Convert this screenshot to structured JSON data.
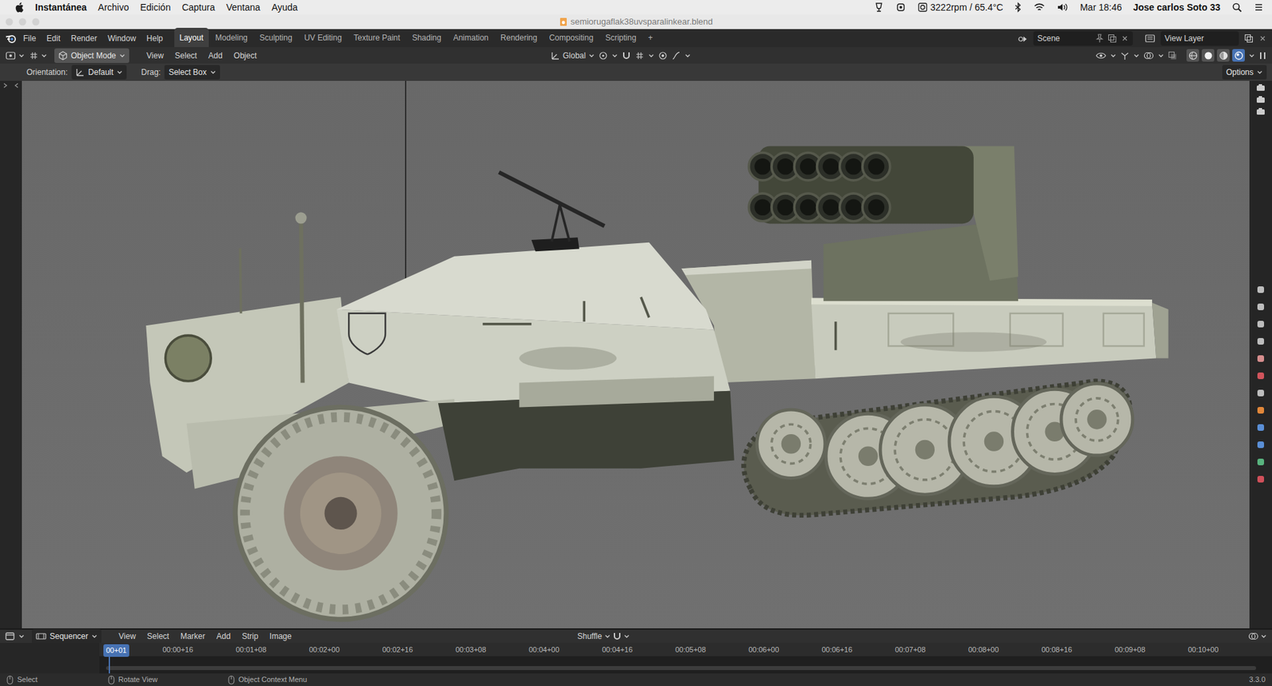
{
  "menubar": {
    "app": "Instantánea",
    "items": [
      "Archivo",
      "Edición",
      "Captura",
      "Ventana",
      "Ayuda"
    ],
    "fan": "3222rpm / 65.4°C",
    "clock": "Mar 18:46",
    "user": "Jose carlos Soto 33"
  },
  "window": {
    "title": "semiorugaflak38uvsparalinkear.blend"
  },
  "topbar": {
    "menus": [
      "File",
      "Edit",
      "Render",
      "Window",
      "Help"
    ],
    "workspaces": [
      {
        "label": "Layout",
        "selected": true
      },
      {
        "label": "Modeling",
        "selected": false
      },
      {
        "label": "Sculpting",
        "selected": false
      },
      {
        "label": "UV Editing",
        "selected": false
      },
      {
        "label": "Texture Paint",
        "selected": false
      },
      {
        "label": "Shading",
        "selected": false
      },
      {
        "label": "Animation",
        "selected": false
      },
      {
        "label": "Rendering",
        "selected": false
      },
      {
        "label": "Compositing",
        "selected": false
      },
      {
        "label": "Scripting",
        "selected": false
      }
    ],
    "add_workspace": "+",
    "scene": "Scene",
    "view_layer": "View Layer"
  },
  "viewport_header": {
    "mode": "Object Mode",
    "menus": [
      "View",
      "Select",
      "Add",
      "Object"
    ],
    "orientation": "Global",
    "shading_modes": [
      {
        "selected": false
      },
      {
        "selected": false
      },
      {
        "selected": false
      },
      {
        "selected": true
      }
    ]
  },
  "tool_settings": {
    "orientation_label": "Orientation:",
    "orientation": "Default",
    "drag_label": "Drag:",
    "drag": "Select Box",
    "options": "Options"
  },
  "sequencer": {
    "editor": "Sequencer",
    "menus": [
      "View",
      "Select",
      "Marker",
      "Add",
      "Strip",
      "Image"
    ],
    "mode": "Shuffle",
    "current_frame": "00+01",
    "ticks": [
      "00:00+16",
      "00:01+08",
      "00:02+00",
      "00:02+16",
      "00:03+08",
      "00:04+00",
      "00:04+16",
      "00:05+08",
      "00:06+00",
      "00:06+16",
      "00:07+08",
      "00:08+00",
      "00:08+16",
      "00:09+08",
      "00:10+00"
    ]
  },
  "status_bar": {
    "hints": [
      "Select",
      "Rotate View",
      "Object Context Menu"
    ],
    "version": "3.3.0"
  }
}
